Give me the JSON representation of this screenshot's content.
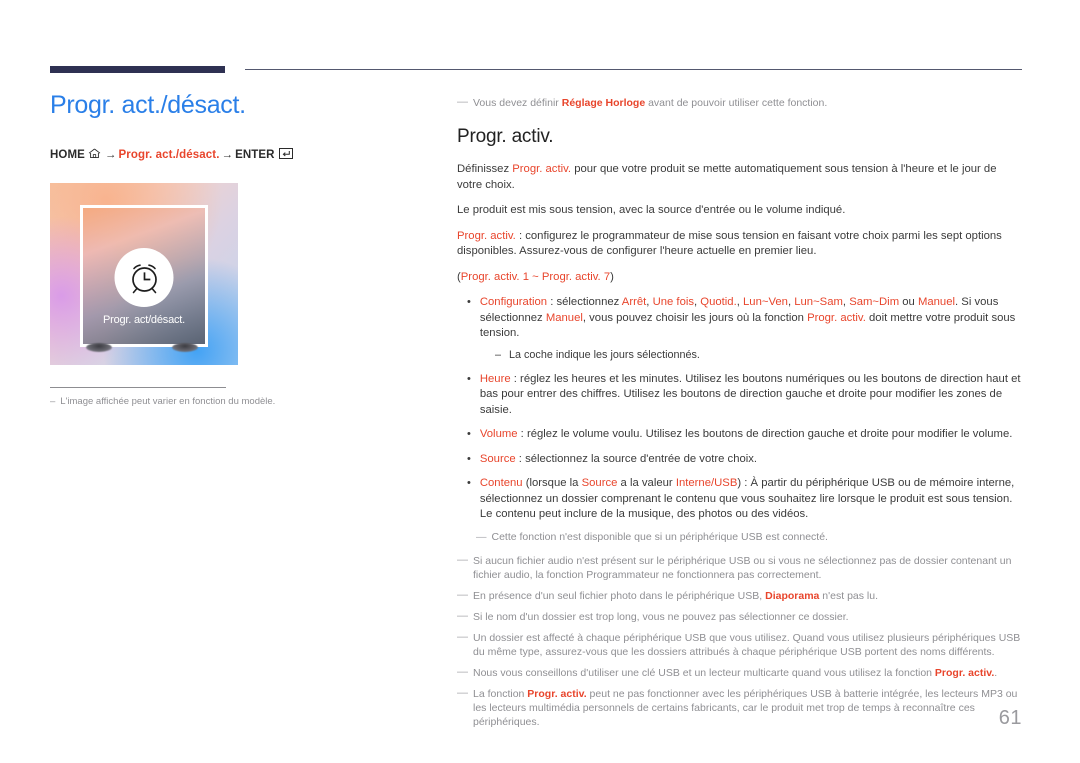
{
  "page": {
    "number": "61",
    "title": "Progr. act./désact."
  },
  "breadcrumb": {
    "home_label": "HOME",
    "home_icon": "home-icon",
    "arrow": "→",
    "middle_label": "Progr. act./désact.",
    "enter_label": "ENTER",
    "enter_icon": "enter-key-icon"
  },
  "thumbnail": {
    "icon": "alarm-clock-icon",
    "screen_label": "Progr. act/désact."
  },
  "left_caption": {
    "dash": "–",
    "text": "L'image affichée peut varier en fonction du modèle."
  },
  "top_note": {
    "dash": "―",
    "prefix": "Vous devez définir ",
    "highlight": "Réglage Horloge",
    "suffix": " avant de pouvoir utiliser cette fonction."
  },
  "section": {
    "heading": "Progr. activ.",
    "paragraphs": [
      {
        "id": "p1",
        "parts": [
          {
            "t": "Définissez ",
            "s": "plain"
          },
          {
            "t": "Progr. activ.",
            "s": "red"
          },
          {
            "t": " pour que votre produit se mette automatiquement sous tension à l'heure et le jour de votre choix.",
            "s": "plain"
          }
        ]
      },
      {
        "id": "p2",
        "parts": [
          {
            "t": "Le produit est mis sous tension, avec la source d'entrée ou le volume indiqué.",
            "s": "plain"
          }
        ]
      },
      {
        "id": "p3",
        "parts": [
          {
            "t": "Progr. activ.",
            "s": "red"
          },
          {
            "t": " : configurez le programmateur de mise sous tension en faisant votre choix parmi les sept options disponibles. Assurez-vous de configurer l'heure actuelle en premier lieu.",
            "s": "plain"
          }
        ]
      },
      {
        "id": "p4",
        "parts": [
          {
            "t": "(",
            "s": "plain"
          },
          {
            "t": "Progr. activ. 1 ~ Progr. activ. 7",
            "s": "red"
          },
          {
            "t": ")",
            "s": "plain"
          }
        ]
      }
    ],
    "bullets": [
      {
        "id": "b-configuration",
        "parts": [
          {
            "t": "Configuration",
            "s": "red"
          },
          {
            "t": " : sélectionnez ",
            "s": "plain"
          },
          {
            "t": "Arrêt",
            "s": "red"
          },
          {
            "t": ", ",
            "s": "plain"
          },
          {
            "t": "Une fois",
            "s": "red"
          },
          {
            "t": ", ",
            "s": "plain"
          },
          {
            "t": "Quotid.",
            "s": "red"
          },
          {
            "t": ", ",
            "s": "plain"
          },
          {
            "t": "Lun~Ven",
            "s": "red"
          },
          {
            "t": ", ",
            "s": "plain"
          },
          {
            "t": "Lun~Sam",
            "s": "red"
          },
          {
            "t": ", ",
            "s": "plain"
          },
          {
            "t": "Sam~Dim",
            "s": "red"
          },
          {
            "t": " ou ",
            "s": "plain"
          },
          {
            "t": "Manuel",
            "s": "red"
          },
          {
            "t": ". Si vous sélectionnez ",
            "s": "plain"
          },
          {
            "t": "Manuel",
            "s": "red"
          },
          {
            "t": ", vous pouvez choisir les jours où la fonction ",
            "s": "plain"
          },
          {
            "t": "Progr. activ.",
            "s": "red"
          },
          {
            "t": " doit mettre votre produit sous tension.",
            "s": "plain"
          }
        ]
      },
      {
        "id": "b-heure",
        "parts": [
          {
            "t": "Heure",
            "s": "red"
          },
          {
            "t": " : réglez les heures et les minutes. Utilisez les boutons numériques ou les boutons de direction haut et bas pour entrer des chiffres. Utilisez les boutons de direction gauche et droite pour modifier les zones de saisie.",
            "s": "plain"
          }
        ]
      },
      {
        "id": "b-volume",
        "parts": [
          {
            "t": "Volume",
            "s": "red"
          },
          {
            "t": " : réglez le volume voulu. Utilisez les boutons de direction gauche et droite pour modifier le volume.",
            "s": "plain"
          }
        ]
      },
      {
        "id": "b-source",
        "parts": [
          {
            "t": "Source",
            "s": "red"
          },
          {
            "t": " : sélectionnez la source d'entrée de votre choix.",
            "s": "plain"
          }
        ]
      },
      {
        "id": "b-contenu",
        "parts": [
          {
            "t": "Contenu",
            "s": "red"
          },
          {
            "t": " (lorsque la ",
            "s": "plain"
          },
          {
            "t": "Source",
            "s": "red"
          },
          {
            "t": " a la valeur ",
            "s": "plain"
          },
          {
            "t": "Interne/USB",
            "s": "red"
          },
          {
            "t": ") : À partir du périphérique USB ou de mémoire interne, sélectionnez un dossier comprenant le contenu que vous souhaitez lire lorsque le produit est sous tension. Le contenu peut inclure de la musique, des photos ou des vidéos.",
            "s": "plain"
          }
        ]
      }
    ],
    "sub_dash": {
      "dash": "–",
      "text": "La coche indique les jours sélectionnés."
    },
    "inner_note": {
      "dash": "―",
      "text": "Cette fonction n'est disponible que si un périphérique USB est connecté."
    },
    "notes": [
      {
        "id": "n1",
        "dash": "―",
        "parts": [
          {
            "t": "Si aucun fichier audio n'est présent sur le périphérique USB ou si vous ne sélectionnez pas de dossier contenant un fichier audio, la fonction Programmateur ne fonctionnera pas correctement.",
            "s": "plain"
          }
        ]
      },
      {
        "id": "n2",
        "dash": "―",
        "parts": [
          {
            "t": "En présence d'un seul fichier photo dans le périphérique USB, ",
            "s": "plain"
          },
          {
            "t": "Diaporama",
            "s": "red-bold"
          },
          {
            "t": " n'est pas lu.",
            "s": "plain"
          }
        ]
      },
      {
        "id": "n3",
        "dash": "―",
        "parts": [
          {
            "t": "Si le nom d'un dossier est trop long, vous ne pouvez pas sélectionner ce dossier.",
            "s": "plain"
          }
        ]
      },
      {
        "id": "n4",
        "dash": "―",
        "parts": [
          {
            "t": "Un dossier est affecté à chaque périphérique USB que vous utilisez. Quand vous utilisez plusieurs périphériques USB du même type, assurez-vous que les dossiers attribués à chaque périphérique USB portent des noms différents.",
            "s": "plain"
          }
        ]
      },
      {
        "id": "n5",
        "dash": "―",
        "parts": [
          {
            "t": "Nous vous conseillons d'utiliser une clé USB et un lecteur multicarte quand vous utilisez la fonction ",
            "s": "plain"
          },
          {
            "t": "Progr. activ.",
            "s": "red-bold"
          },
          {
            "t": ".",
            "s": "plain"
          }
        ]
      },
      {
        "id": "n6",
        "dash": "―",
        "parts": [
          {
            "t": "La fonction ",
            "s": "plain"
          },
          {
            "t": "Progr. activ.",
            "s": "red-bold"
          },
          {
            "t": " peut ne pas fonctionner avec les périphériques USB à batterie intégrée, les lecteurs MP3 ou les lecteurs multimédia personnels de certains fabricants, car le produit met trop de temps à reconnaître ces périphériques.",
            "s": "plain"
          }
        ]
      }
    ]
  },
  "colors": {
    "title_blue": "#2a7fe8",
    "accent_red": "#e8452c",
    "rule_navy": "#2e3152",
    "note_gray": "#8f8f93"
  }
}
